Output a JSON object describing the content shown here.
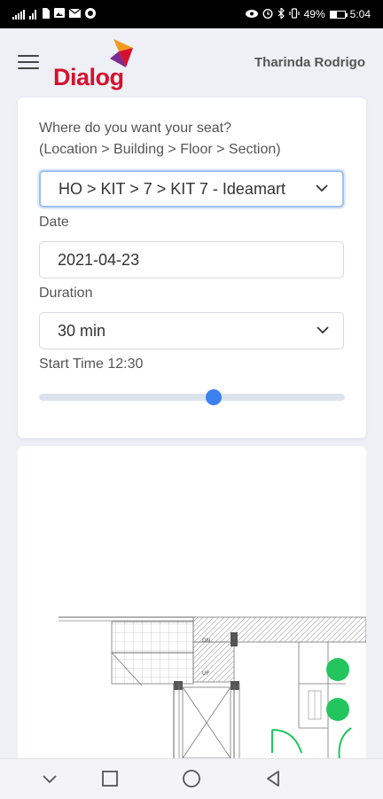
{
  "status_bar": {
    "battery_text": "49%",
    "time": "5:04",
    "battery_level": 0.49,
    "left_icons": [
      "signal-icon",
      "wifi-signal-icon",
      "sim-icon",
      "image-notification-icon",
      "mail-icon",
      "app-notification-icon"
    ],
    "right_icons": [
      "eye-icon",
      "alarm-icon",
      "bluetooth-icon",
      "vibrate-icon",
      "battery-icon"
    ]
  },
  "header": {
    "logo_text": "Dialog",
    "user_name": "Tharinda Rodrigo"
  },
  "booking": {
    "question_line1": "Where do you want your seat?",
    "question_line2": "(Location > Building > Floor > Section)",
    "location_value": "HO > KIT > 7 > KIT 7 - Ideamart",
    "date_label": "Date",
    "date_value": "2021-04-23",
    "duration_label": "Duration",
    "duration_value": "30 min",
    "start_time_label": "Start Time 12:30",
    "slider_fraction": 0.57
  },
  "floor_plan": {
    "room_labels": [
      "DN",
      "UP"
    ],
    "seat_color": "#22c55e"
  },
  "nav": {
    "buttons": [
      "chevron-down-icon",
      "recent-apps-icon",
      "home-icon",
      "back-icon"
    ]
  },
  "colors": {
    "brand_red": "#d6112e",
    "brand_orange": "#f39a1e",
    "brand_purple": "#7b2a90",
    "accent_blue": "#3b82f0"
  }
}
